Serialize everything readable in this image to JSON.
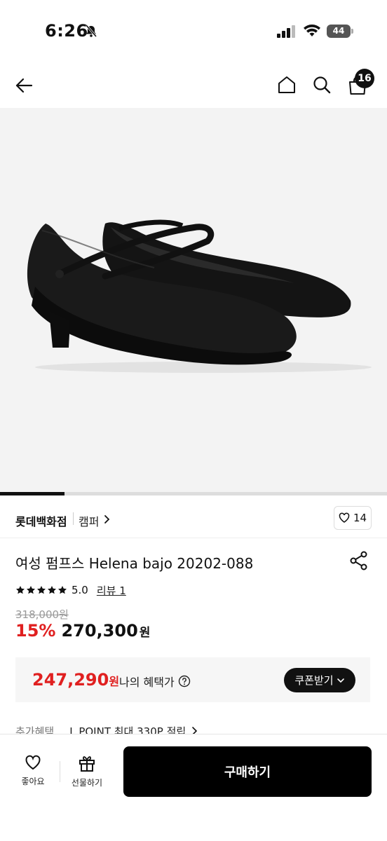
{
  "status_bar": {
    "time": "6:26",
    "battery": "44"
  },
  "header": {
    "cart_count": "16"
  },
  "product": {
    "image_alt": "Black women's pumps with ankle strap",
    "gallery_progress": 0.166,
    "store": "롯데백화점",
    "brand": "캠퍼",
    "like_count": "14",
    "title": "여성 펌프스 Helena bajo 20202-088",
    "rating": "5.0",
    "stars": 5,
    "review_link": "리뷰 1",
    "original_price": "318,000원",
    "discount": "15%",
    "sale_price": "270,300",
    "currency": "원"
  },
  "benefit": {
    "price": "247,290",
    "currency": "원",
    "label": "나의 혜택가",
    "coupon_button": "쿠폰받기"
  },
  "extra_benefit": {
    "label": "추가혜택",
    "text": "L.POINT 최대 330P 적립"
  },
  "bottom_bar": {
    "wish_label": "좋아요",
    "gift_label": "선물하기",
    "buy_label": "구매하기"
  },
  "colors": {
    "accent_red": "#e02020",
    "black": "#111111"
  }
}
